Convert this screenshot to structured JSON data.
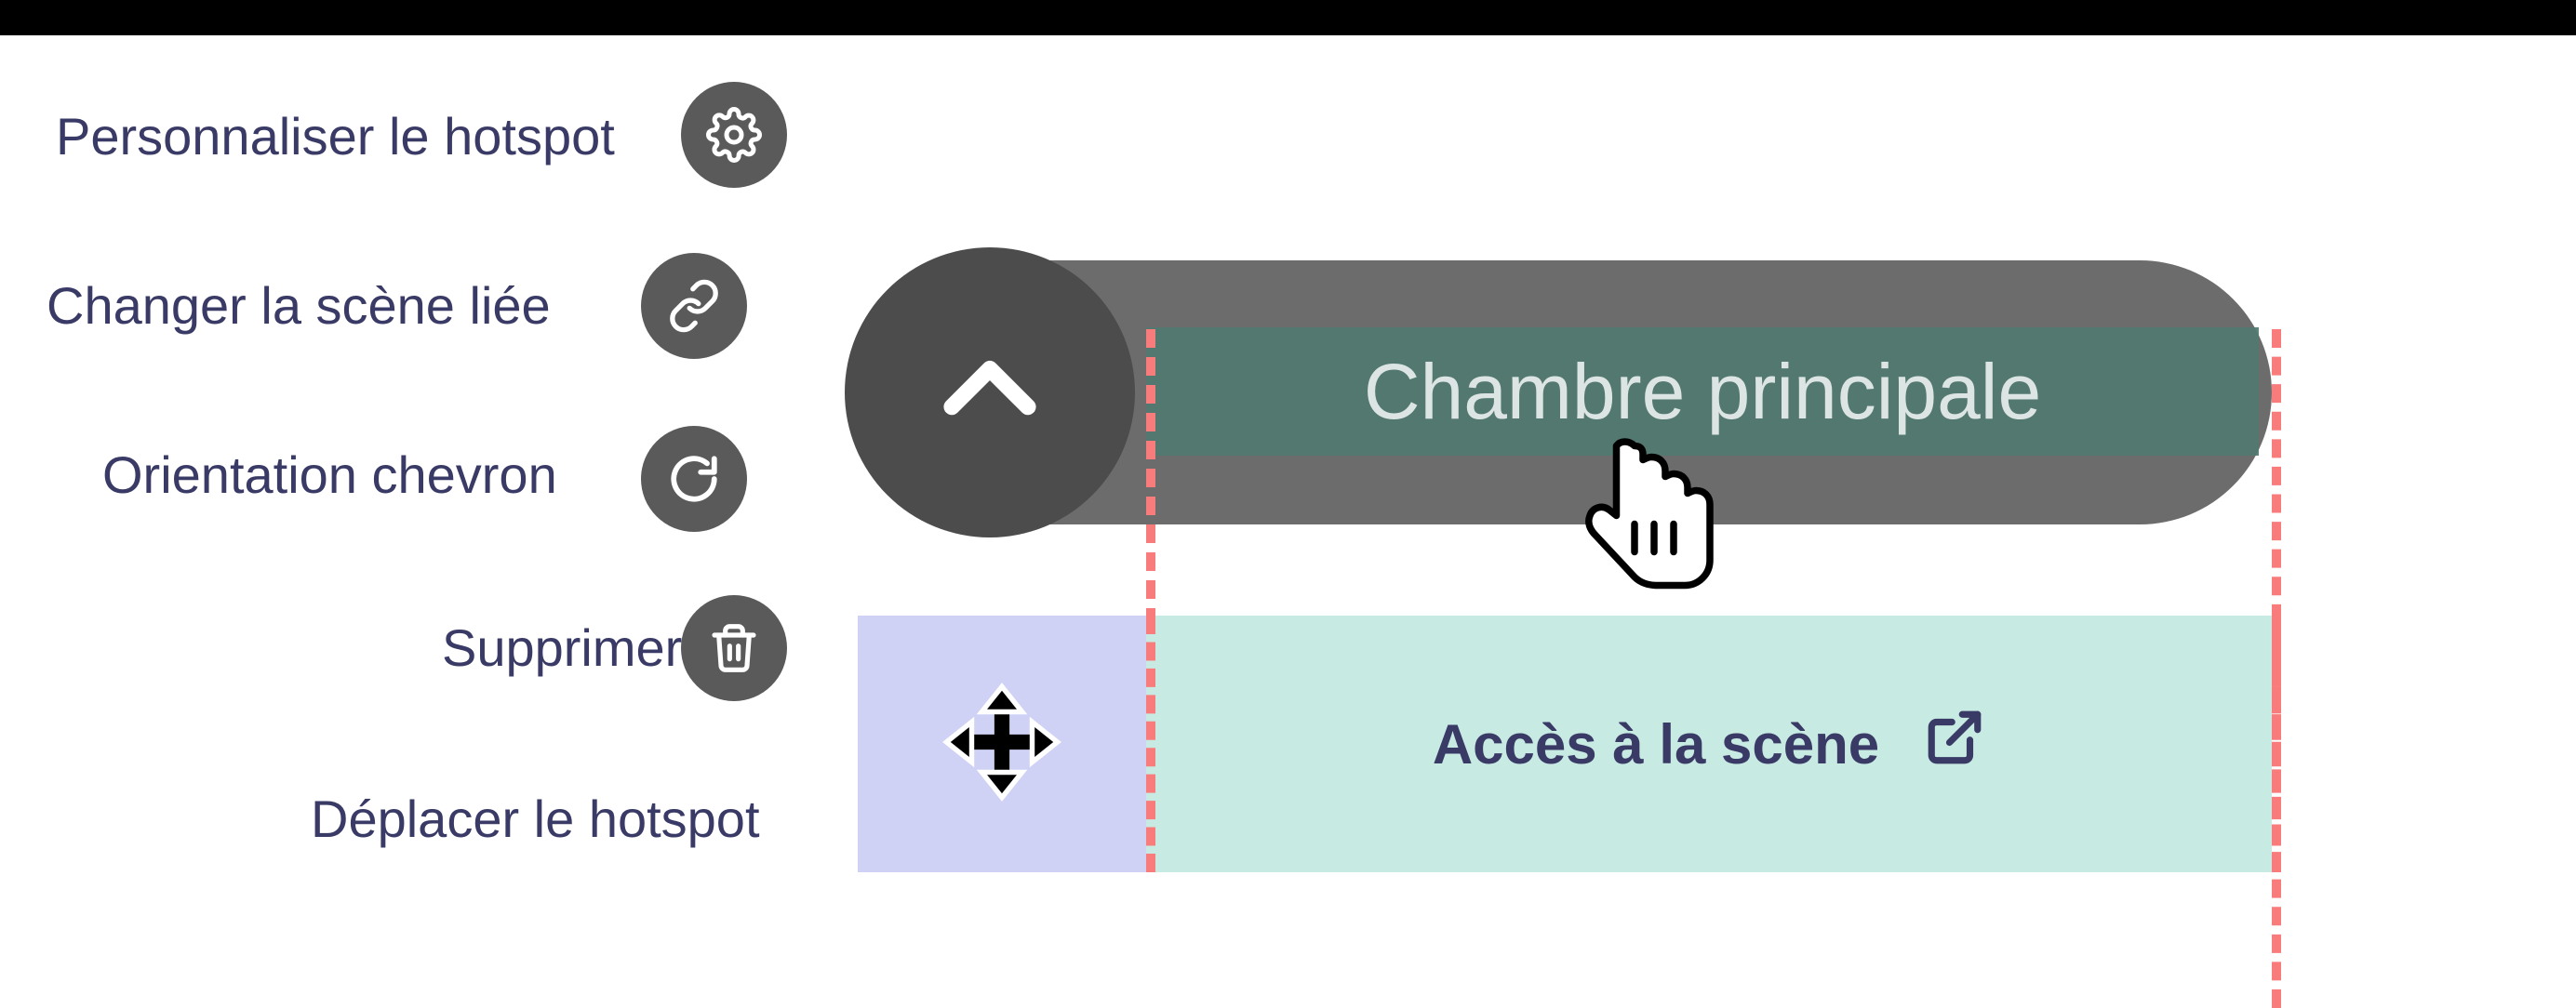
{
  "labels": {
    "personalize": "Personnaliser le hotspot",
    "change": "Changer la scène liée",
    "orient": "Orientation chevron",
    "delete": "Supprimer",
    "move": "Déplacer le hotspot"
  },
  "hotspot": {
    "title": "Chambre principale"
  },
  "panel": {
    "scene_access": "Accès à la scène"
  },
  "icons": {
    "gear": "gear-icon",
    "link": "link-icon",
    "rotate": "rotate-icon",
    "trash": "trash-icon",
    "chevron": "chevron-up-icon",
    "move": "move-icon",
    "external": "external-link-icon",
    "pointer": "pointer-cursor-icon"
  },
  "colors": {
    "ink": "#3a3a66",
    "menu_bg": "#5a5a5a",
    "pill_bg": "#605f5f",
    "teal": "#517a70",
    "light_teal": "#c7ebe2",
    "light_blue": "#cfd2f5",
    "dash": "#f87c7c"
  }
}
